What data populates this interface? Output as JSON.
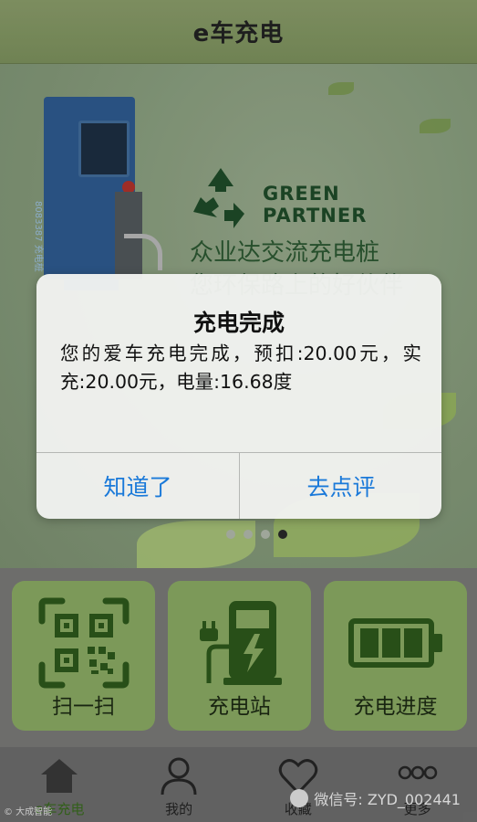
{
  "nav": {
    "title": "e车充电"
  },
  "banner": {
    "green_line1": "GREEN",
    "green_line2": "PARTNER",
    "slogan_line1": "众业达交流充电桩",
    "slogan_line2": "您环保路上的好伙伴",
    "charger_serial": "8083387  充电桩",
    "page_count": 4,
    "active_page": 4
  },
  "tiles": [
    {
      "label": "扫一扫",
      "icon": "qr-scan-icon"
    },
    {
      "label": "充电站",
      "icon": "charging-station-icon"
    },
    {
      "label": "充电进度",
      "icon": "battery-progress-icon"
    }
  ],
  "tabs": [
    {
      "label": "e车充电",
      "icon": "home-icon",
      "active": true
    },
    {
      "label": "我的",
      "icon": "person-icon",
      "active": false
    },
    {
      "label": "收藏",
      "icon": "heart-icon",
      "active": false
    },
    {
      "label": "更多",
      "icon": "more-icon",
      "active": false
    }
  ],
  "alert": {
    "title": "充电完成",
    "message": "您的爱车充电完成，预扣:20.00元，实充:20.00元，电量:16.68度",
    "button_left": "知道了",
    "button_right": "去点评"
  },
  "watermark": {
    "text": "微信号: ZYD_002441",
    "corner": "© 大成智能"
  },
  "colors": {
    "accent_green": "#3a6d1e",
    "tile_green": "#8eaf66",
    "alert_button": "#1a79d9"
  }
}
